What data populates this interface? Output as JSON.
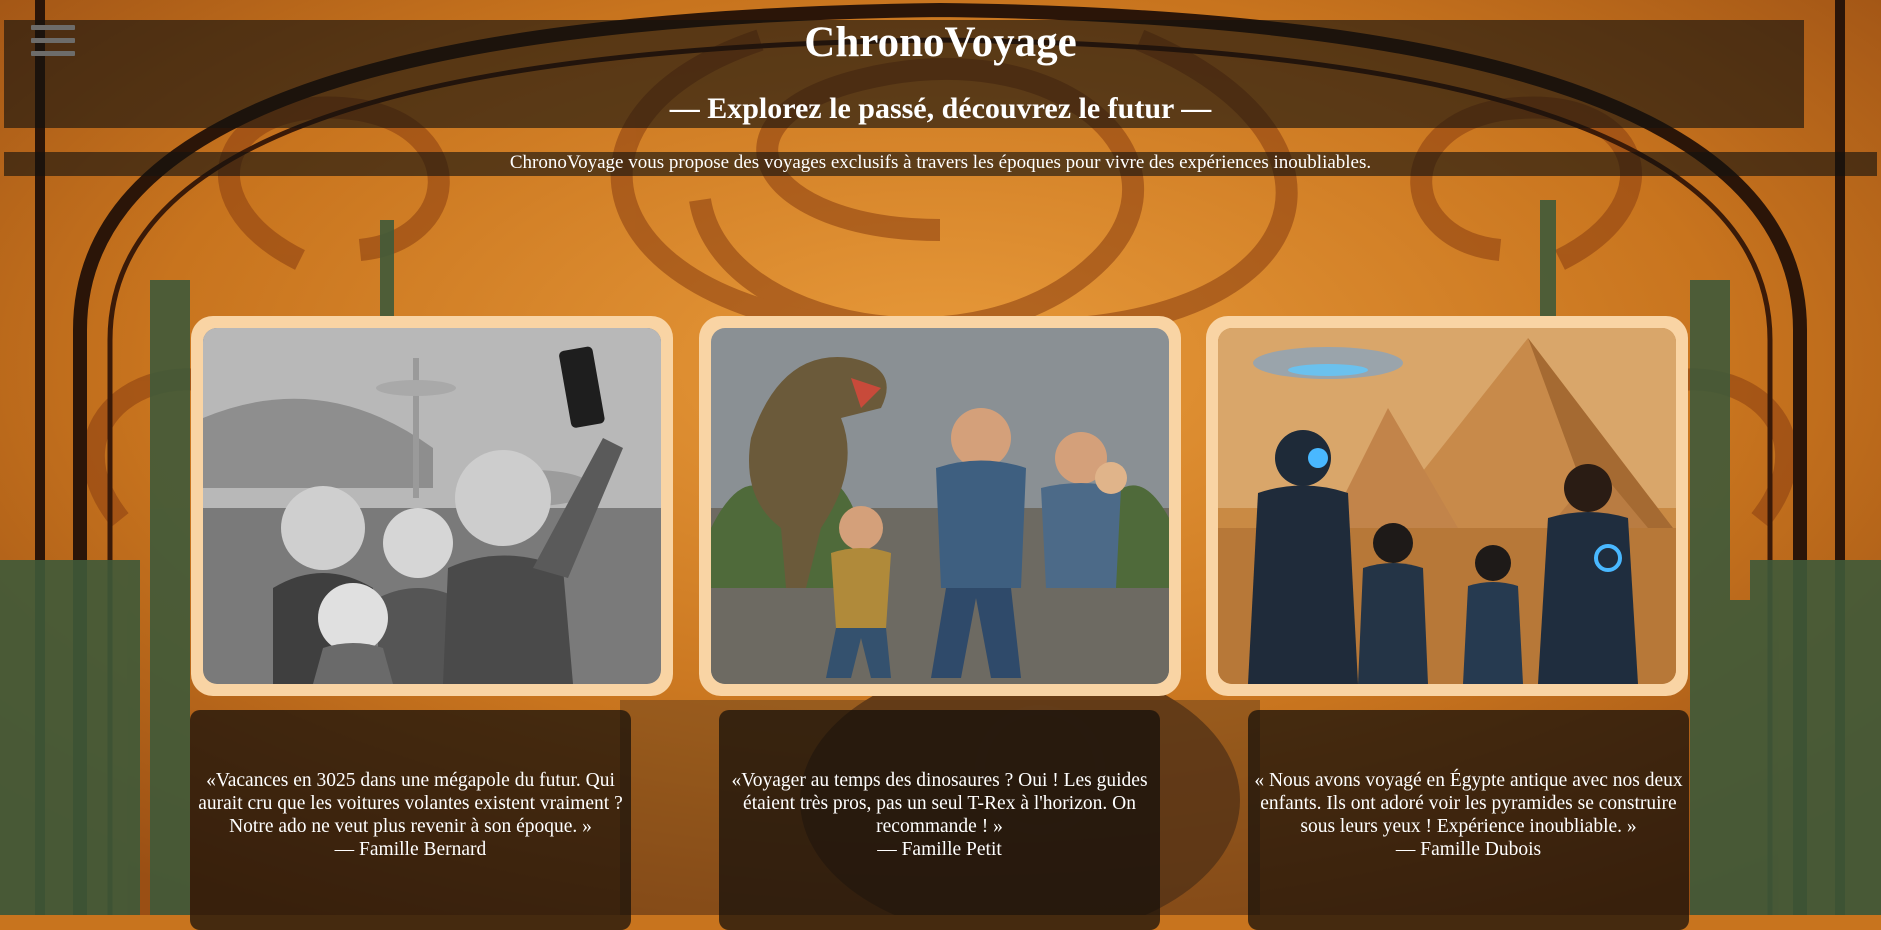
{
  "header": {
    "menu_icon": "hamburger-menu-icon",
    "title": "ChronoVoyage",
    "tagline": "— Explorez le passé, découvrez le futur —",
    "intro": "ChronoVoyage vous propose des voyages exclusifs à travers les époques pour vivre des expériences inoubliables."
  },
  "colors": {
    "card_background": "#f9d4a4",
    "overlay": "#141210",
    "background_orange": "#c8741e",
    "text": "#ffffff"
  },
  "gallery": [
    {
      "image": "retro-futuristic-family-selfie-photo"
    },
    {
      "image": "family-fleeing-t-rex-photo"
    },
    {
      "image": "family-with-robots-at-pyramids-photo"
    }
  ],
  "testimonials": [
    {
      "quote": "«Vacances en 3025 dans une mégapole du futur. Qui aurait cru que les voitures volantes existent vraiment ? Notre ado ne veut plus revenir à son époque. »",
      "author": "— Famille Bernard"
    },
    {
      "quote": "«Voyager au temps des dinosaures ? Oui ! Les guides étaient très pros, pas un seul T-Rex à l'horizon. On recommande ! »",
      "author": "— Famille Petit"
    },
    {
      "quote": "« Nous avons voyagé en Égypte antique avec nos deux enfants. Ils ont adoré voir les pyramides se construire sous leurs yeux ! Expérience inoubliable. »",
      "author": "— Famille Dubois"
    }
  ]
}
